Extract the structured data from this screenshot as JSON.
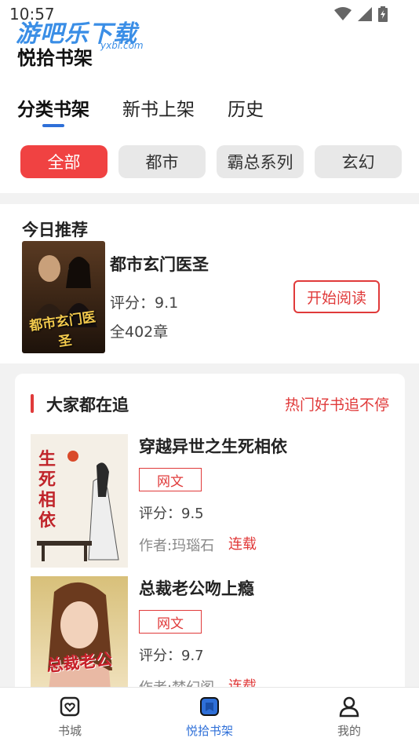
{
  "status_bar": {
    "time": "10:57"
  },
  "watermark": {
    "logo_text": "游吧乐下载",
    "logo_sub": "yxbl.com"
  },
  "page": {
    "title": "悦拾书架"
  },
  "tabs": [
    {
      "label": "分类书架",
      "active": true
    },
    {
      "label": "新书上架",
      "active": false
    },
    {
      "label": "历史",
      "active": false
    }
  ],
  "categories": [
    {
      "label": "全部",
      "active": true
    },
    {
      "label": "都市",
      "active": false
    },
    {
      "label": "霸总系列",
      "active": false
    },
    {
      "label": "玄幻",
      "active": false
    }
  ],
  "recommendation": {
    "section_title": "今日推荐",
    "book_title": "都市玄门医圣",
    "score": "评分：9.1",
    "chapters": "全402章",
    "read_button": "开始阅读",
    "cover_text": "都市玄门医圣"
  },
  "trending": {
    "section_title": "大家都在追",
    "more_link": "热门好书追不停",
    "books": [
      {
        "title": "穿越异世之生死相依",
        "tag": "网文",
        "score": "评分：9.5",
        "author": "作者:玛瑙石",
        "status": "连载",
        "cover_text": "生死相依"
      },
      {
        "title": "总裁老公吻上瘾",
        "tag": "网文",
        "score": "评分：9.7",
        "author": "作者:梦幻阁",
        "status": "连载",
        "cover_text": "总裁老公"
      }
    ]
  },
  "bottom_nav": [
    {
      "label": "书城",
      "icon": "heart-bag-icon",
      "active": false
    },
    {
      "label": "悦拾书架",
      "icon": "bookshelf-icon",
      "active": true
    },
    {
      "label": "我的",
      "icon": "person-icon",
      "active": false
    }
  ],
  "colors": {
    "accent_red": "#e03a3a",
    "chip_active": "#f04242",
    "accent_blue": "#2e6fd8"
  }
}
